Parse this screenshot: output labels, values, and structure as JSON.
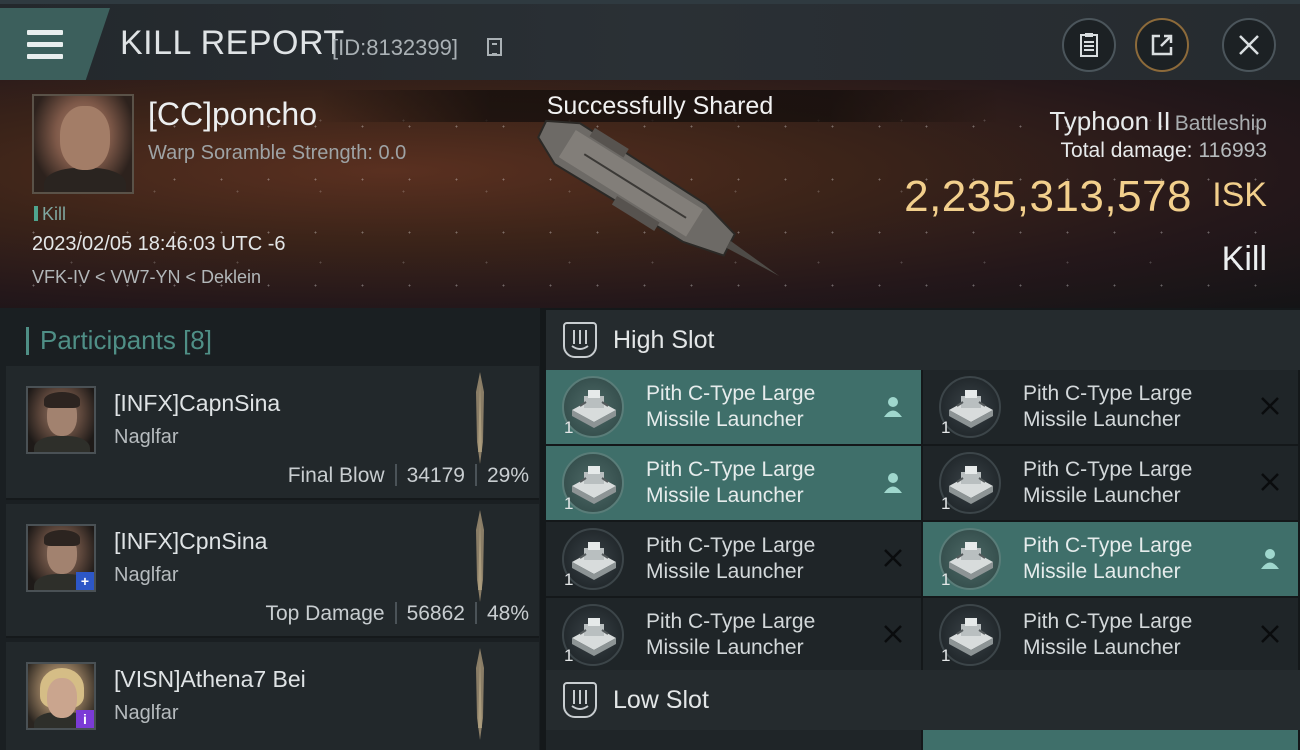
{
  "header": {
    "title": "KILL REPORT",
    "id_text": "[ID:8132399]",
    "icons": [
      "menu-icon",
      "copy-icon",
      "clipboard-icon",
      "share-icon",
      "close-icon"
    ]
  },
  "banner": {
    "toast": "Successfully Shared",
    "victim_name": "[CC]poncho",
    "scram_label": "Warp Soramble Strength: 0.0",
    "kill_tag": "Kill",
    "date": "2023/02/05 18:46:03 UTC -6",
    "location": "VFK-IV < VW7-YN < Deklein",
    "ship_name": "Typhoon II",
    "ship_class": "Battleship",
    "total_damage_label": "Total damage:",
    "total_damage_value": "116993",
    "isk_value": "2,235,313,578",
    "isk_unit": "ISK",
    "result": "Kill"
  },
  "participants": {
    "label": "Participants",
    "count": "[8]",
    "rows": [
      {
        "name": "[INFX]CapnSina",
        "ship": "Naglfar",
        "role": "Final Blow",
        "damage": "34179",
        "percent": "29%"
      },
      {
        "name": "[INFX]CpnSina",
        "ship": "Naglfar",
        "role": "Top Damage",
        "damage": "56862",
        "percent": "48%",
        "badge": "+"
      },
      {
        "name": "[VISN]Athena7 Bei",
        "ship": "Naglfar",
        "badge": "i"
      }
    ]
  },
  "fitting": {
    "high_slot_label": "High Slot",
    "low_slot_label": "Low Slot",
    "high_slots": [
      {
        "line1": "Pith C-Type Large",
        "line2": "Missile Launcher",
        "qty": "1",
        "status": "dropped"
      },
      {
        "line1": "Pith C-Type Large",
        "line2": "Missile Launcher",
        "qty": "1",
        "status": "destroyed"
      },
      {
        "line1": "Pith C-Type Large",
        "line2": "Missile Launcher",
        "qty": "1",
        "status": "dropped"
      },
      {
        "line1": "Pith C-Type Large",
        "line2": "Missile Launcher",
        "qty": "1",
        "status": "destroyed"
      },
      {
        "line1": "Pith C-Type Large",
        "line2": "Missile Launcher",
        "qty": "1",
        "status": "destroyed"
      },
      {
        "line1": "Pith C-Type Large",
        "line2": "Missile Launcher",
        "qty": "1",
        "status": "dropped"
      },
      {
        "line1": "Pith C-Type Large",
        "line2": "Missile Launcher",
        "qty": "1",
        "status": "destroyed"
      },
      {
        "line1": "Pith C-Type Large",
        "line2": "Missile Launcher",
        "qty": "1",
        "status": "destroyed"
      }
    ]
  },
  "colors": {
    "accent_teal": "#3f6f6a",
    "isk_gold": "#f2cf8c",
    "participants_label": "#4f8f86"
  }
}
